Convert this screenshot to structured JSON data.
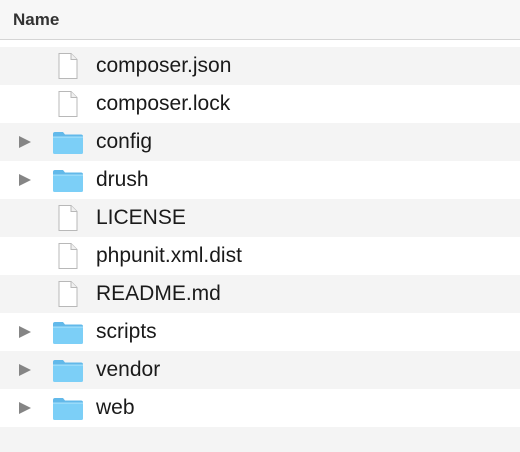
{
  "header": {
    "name_label": "Name"
  },
  "colors": {
    "folder": "#7ccff7",
    "folder_dark": "#62b9ea",
    "row_alt": "#f4f4f4"
  },
  "files": [
    {
      "name": "composer.json",
      "kind": "file",
      "icon": "document-icon"
    },
    {
      "name": "composer.lock",
      "kind": "file",
      "icon": "document-icon"
    },
    {
      "name": "config",
      "kind": "folder",
      "icon": "folder-icon",
      "expanded": false
    },
    {
      "name": "drush",
      "kind": "folder",
      "icon": "folder-icon",
      "expanded": false
    },
    {
      "name": "LICENSE",
      "kind": "file",
      "icon": "document-icon"
    },
    {
      "name": "phpunit.xml.dist",
      "kind": "file",
      "icon": "document-icon"
    },
    {
      "name": "README.md",
      "kind": "file",
      "icon": "document-icon"
    },
    {
      "name": "scripts",
      "kind": "folder",
      "icon": "folder-icon",
      "expanded": false
    },
    {
      "name": "vendor",
      "kind": "folder",
      "icon": "folder-icon",
      "expanded": false
    },
    {
      "name": "web",
      "kind": "folder",
      "icon": "folder-icon",
      "expanded": false
    }
  ]
}
